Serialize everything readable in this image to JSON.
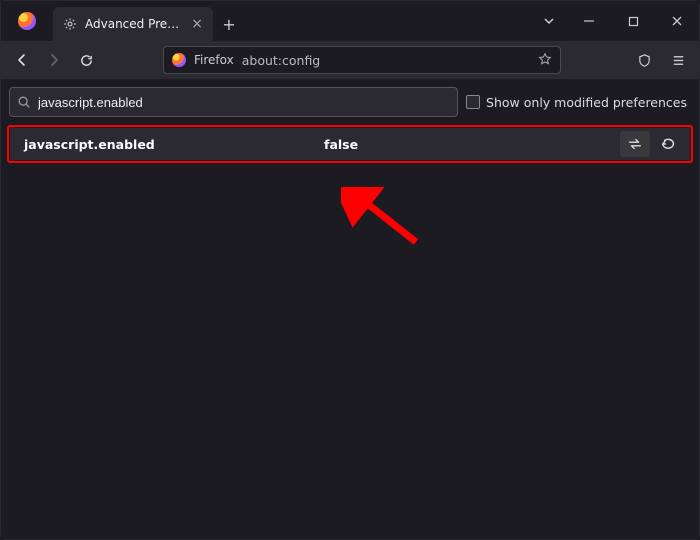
{
  "window": {
    "tab_title": "Advanced Preferences"
  },
  "toolbar": {
    "identity_label": "Firefox",
    "address": "about:config"
  },
  "config": {
    "search_value": "javascript.enabled",
    "show_modified_label": "Show only modified preferences",
    "pref": {
      "name": "javascript.enabled",
      "value": "false"
    }
  }
}
